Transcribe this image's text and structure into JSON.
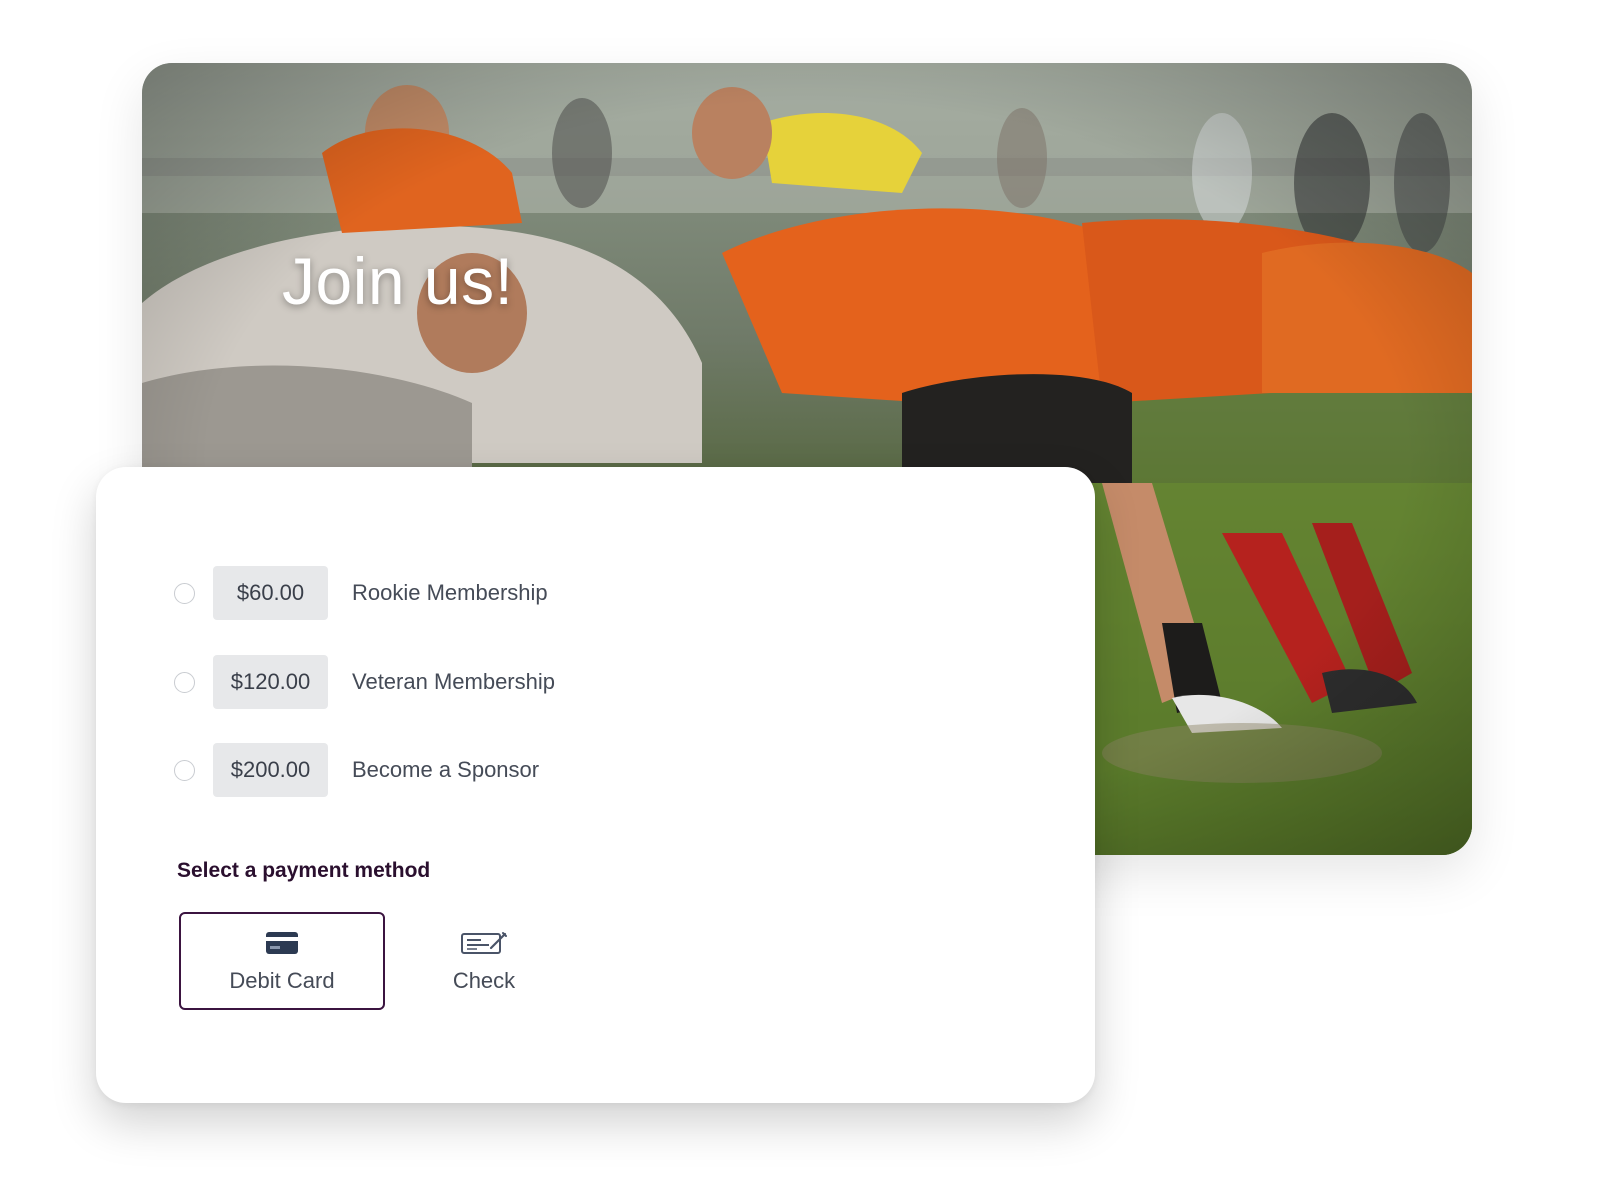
{
  "hero": {
    "title": "Join us!"
  },
  "plans": [
    {
      "price": "$60.00",
      "label": "Rookie Membership",
      "selected": false
    },
    {
      "price": "$120.00",
      "label": "Veteran Membership",
      "selected": false
    },
    {
      "price": "$200.00",
      "label": "Become a Sponsor",
      "selected": false
    }
  ],
  "payment": {
    "heading": "Select a payment method",
    "methods": [
      {
        "label": "Debit Card",
        "icon": "credit-card-icon",
        "selected": true
      },
      {
        "label": "Check",
        "icon": "check-icon",
        "selected": false
      }
    ]
  },
  "colors": {
    "accent": "#3b1440",
    "heading": "#2a0f2e",
    "price_bg": "#e7e8ea",
    "text": "#454b57"
  }
}
